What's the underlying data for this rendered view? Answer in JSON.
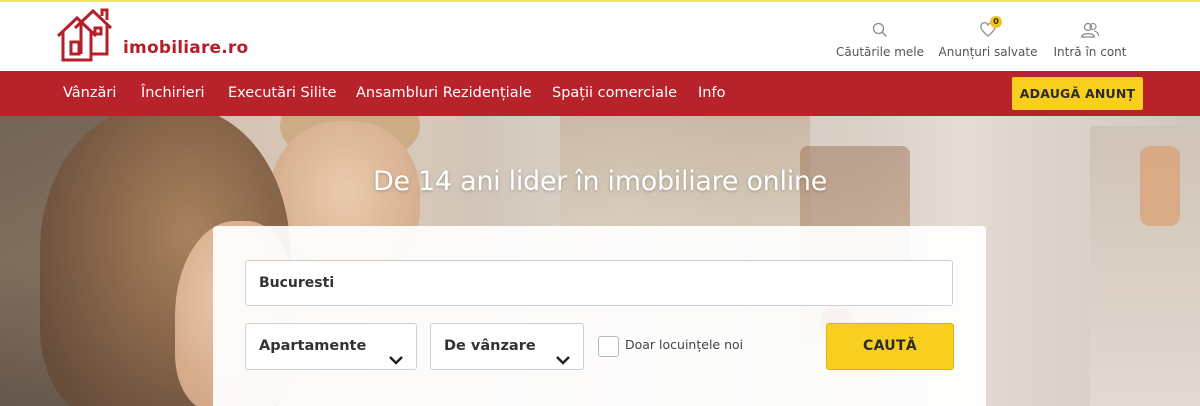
{
  "header": {
    "logo_text": "imobiliare.ro",
    "links": [
      {
        "label": "Căutările mele",
        "icon": "search-icon"
      },
      {
        "label": "Anunțuri salvate",
        "icon": "heart-icon",
        "badge": "0"
      },
      {
        "label": "Intră în cont",
        "icon": "user-icon"
      }
    ]
  },
  "nav": {
    "items": [
      "Vânzări",
      "Închirieri",
      "Executări Silite",
      "Ansambluri Rezidențiale",
      "Spații comerciale",
      "Info"
    ],
    "add_button": "ADAUGĂ ANUNȚ"
  },
  "hero": {
    "headline": "De 14 ani lider în imobiliare online"
  },
  "search": {
    "location_value": "Bucuresti",
    "property_type": "Apartamente",
    "transaction_type": "De vânzare",
    "new_only_label": "Doar locuințele noi",
    "new_only_checked": false,
    "submit_label": "CAUTĂ"
  },
  "colors": {
    "brand_red": "#b8232b",
    "accent_yellow": "#f8cf1e"
  }
}
